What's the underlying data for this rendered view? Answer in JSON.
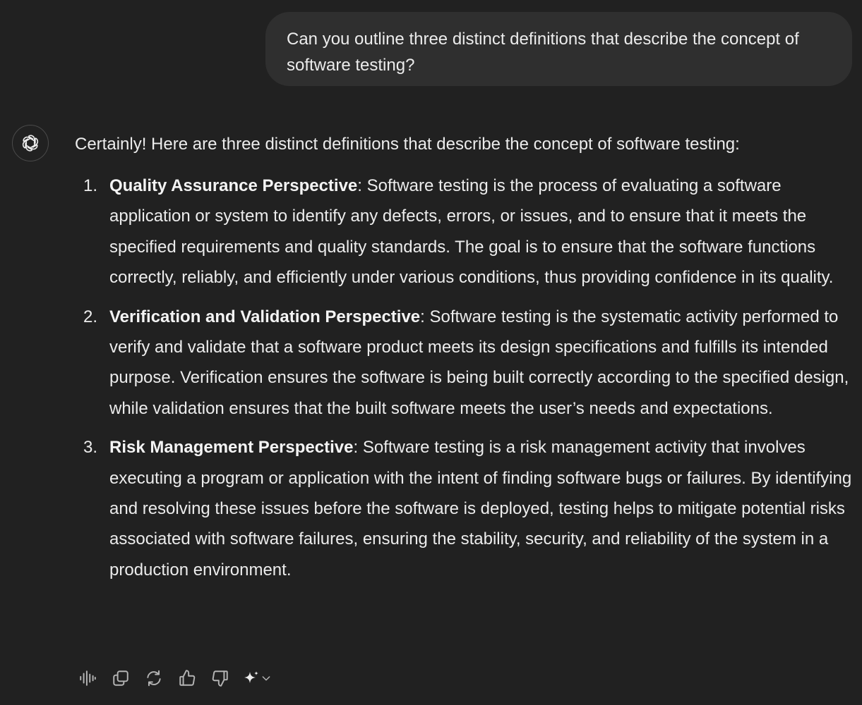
{
  "conversation": {
    "user_message": "Can you outline three distinct definitions that describe the concept of software testing?",
    "assistant": {
      "avatar_icon": "openai-logo-icon",
      "intro": "Certainly! Here are three distinct definitions that describe the concept of software testing:",
      "definitions": [
        {
          "number": "1.",
          "term": "Quality Assurance Perspective",
          "text": ": Software testing is the process of evaluating a software application or system to identify any defects, errors, or issues, and to ensure that it meets the specified requirements and quality standards. The goal is to ensure that the software functions correctly, reliably, and efficiently under various conditions, thus providing confidence in its quality."
        },
        {
          "number": "2.",
          "term": "Verification and Validation Perspective",
          "text": ": Software testing is the systematic activity performed to verify and validate that a software product meets its design specifications and fulfills its intended purpose. Verification ensures the software is being built correctly according to the specified design, while validation ensures that the built software meets the user’s needs and expectations."
        },
        {
          "number": "3.",
          "term": "Risk Management Perspective",
          "text": ": Software testing is a risk management activity that involves executing a program or application with the intent of finding software bugs or failures. By identifying and resolving these issues before the software is deployed, testing helps to mitigate potential risks associated with software failures, ensuring the stability, security, and reliability of the system in a production environment."
        }
      ]
    },
    "actions": [
      {
        "icon": "read-aloud-icon"
      },
      {
        "icon": "copy-icon"
      },
      {
        "icon": "regenerate-icon"
      },
      {
        "icon": "thumbs-up-icon"
      },
      {
        "icon": "thumbs-down-icon"
      },
      {
        "icon": "sparkle-model-icon"
      }
    ]
  },
  "colors": {
    "background": "#212121",
    "user_bubble": "#2f2f2f",
    "text": "#ececec",
    "icon": "#b4b4b4"
  }
}
